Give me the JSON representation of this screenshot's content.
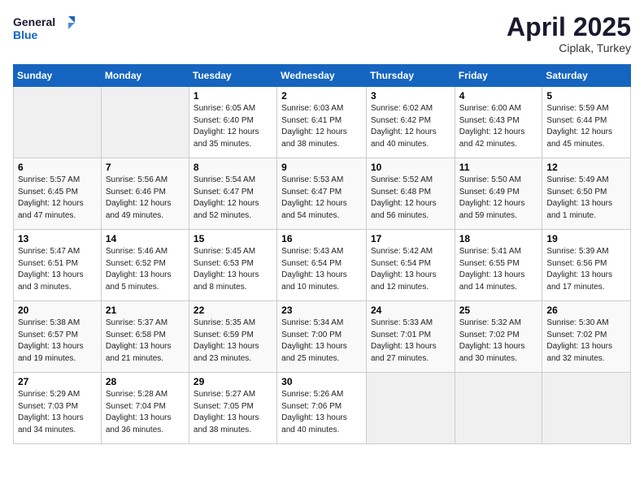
{
  "header": {
    "logo_line1": "General",
    "logo_line2": "Blue",
    "month": "April 2025",
    "location": "Ciplak, Turkey"
  },
  "weekdays": [
    "Sunday",
    "Monday",
    "Tuesday",
    "Wednesday",
    "Thursday",
    "Friday",
    "Saturday"
  ],
  "weeks": [
    [
      {
        "day": "",
        "info": ""
      },
      {
        "day": "",
        "info": ""
      },
      {
        "day": "1",
        "info": "Sunrise: 6:05 AM\nSunset: 6:40 PM\nDaylight: 12 hours and 35 minutes."
      },
      {
        "day": "2",
        "info": "Sunrise: 6:03 AM\nSunset: 6:41 PM\nDaylight: 12 hours and 38 minutes."
      },
      {
        "day": "3",
        "info": "Sunrise: 6:02 AM\nSunset: 6:42 PM\nDaylight: 12 hours and 40 minutes."
      },
      {
        "day": "4",
        "info": "Sunrise: 6:00 AM\nSunset: 6:43 PM\nDaylight: 12 hours and 42 minutes."
      },
      {
        "day": "5",
        "info": "Sunrise: 5:59 AM\nSunset: 6:44 PM\nDaylight: 12 hours and 45 minutes."
      }
    ],
    [
      {
        "day": "6",
        "info": "Sunrise: 5:57 AM\nSunset: 6:45 PM\nDaylight: 12 hours and 47 minutes."
      },
      {
        "day": "7",
        "info": "Sunrise: 5:56 AM\nSunset: 6:46 PM\nDaylight: 12 hours and 49 minutes."
      },
      {
        "day": "8",
        "info": "Sunrise: 5:54 AM\nSunset: 6:47 PM\nDaylight: 12 hours and 52 minutes."
      },
      {
        "day": "9",
        "info": "Sunrise: 5:53 AM\nSunset: 6:47 PM\nDaylight: 12 hours and 54 minutes."
      },
      {
        "day": "10",
        "info": "Sunrise: 5:52 AM\nSunset: 6:48 PM\nDaylight: 12 hours and 56 minutes."
      },
      {
        "day": "11",
        "info": "Sunrise: 5:50 AM\nSunset: 6:49 PM\nDaylight: 12 hours and 59 minutes."
      },
      {
        "day": "12",
        "info": "Sunrise: 5:49 AM\nSunset: 6:50 PM\nDaylight: 13 hours and 1 minute."
      }
    ],
    [
      {
        "day": "13",
        "info": "Sunrise: 5:47 AM\nSunset: 6:51 PM\nDaylight: 13 hours and 3 minutes."
      },
      {
        "day": "14",
        "info": "Sunrise: 5:46 AM\nSunset: 6:52 PM\nDaylight: 13 hours and 5 minutes."
      },
      {
        "day": "15",
        "info": "Sunrise: 5:45 AM\nSunset: 6:53 PM\nDaylight: 13 hours and 8 minutes."
      },
      {
        "day": "16",
        "info": "Sunrise: 5:43 AM\nSunset: 6:54 PM\nDaylight: 13 hours and 10 minutes."
      },
      {
        "day": "17",
        "info": "Sunrise: 5:42 AM\nSunset: 6:54 PM\nDaylight: 13 hours and 12 minutes."
      },
      {
        "day": "18",
        "info": "Sunrise: 5:41 AM\nSunset: 6:55 PM\nDaylight: 13 hours and 14 minutes."
      },
      {
        "day": "19",
        "info": "Sunrise: 5:39 AM\nSunset: 6:56 PM\nDaylight: 13 hours and 17 minutes."
      }
    ],
    [
      {
        "day": "20",
        "info": "Sunrise: 5:38 AM\nSunset: 6:57 PM\nDaylight: 13 hours and 19 minutes."
      },
      {
        "day": "21",
        "info": "Sunrise: 5:37 AM\nSunset: 6:58 PM\nDaylight: 13 hours and 21 minutes."
      },
      {
        "day": "22",
        "info": "Sunrise: 5:35 AM\nSunset: 6:59 PM\nDaylight: 13 hours and 23 minutes."
      },
      {
        "day": "23",
        "info": "Sunrise: 5:34 AM\nSunset: 7:00 PM\nDaylight: 13 hours and 25 minutes."
      },
      {
        "day": "24",
        "info": "Sunrise: 5:33 AM\nSunset: 7:01 PM\nDaylight: 13 hours and 27 minutes."
      },
      {
        "day": "25",
        "info": "Sunrise: 5:32 AM\nSunset: 7:02 PM\nDaylight: 13 hours and 30 minutes."
      },
      {
        "day": "26",
        "info": "Sunrise: 5:30 AM\nSunset: 7:02 PM\nDaylight: 13 hours and 32 minutes."
      }
    ],
    [
      {
        "day": "27",
        "info": "Sunrise: 5:29 AM\nSunset: 7:03 PM\nDaylight: 13 hours and 34 minutes."
      },
      {
        "day": "28",
        "info": "Sunrise: 5:28 AM\nSunset: 7:04 PM\nDaylight: 13 hours and 36 minutes."
      },
      {
        "day": "29",
        "info": "Sunrise: 5:27 AM\nSunset: 7:05 PM\nDaylight: 13 hours and 38 minutes."
      },
      {
        "day": "30",
        "info": "Sunrise: 5:26 AM\nSunset: 7:06 PM\nDaylight: 13 hours and 40 minutes."
      },
      {
        "day": "",
        "info": ""
      },
      {
        "day": "",
        "info": ""
      },
      {
        "day": "",
        "info": ""
      }
    ]
  ]
}
